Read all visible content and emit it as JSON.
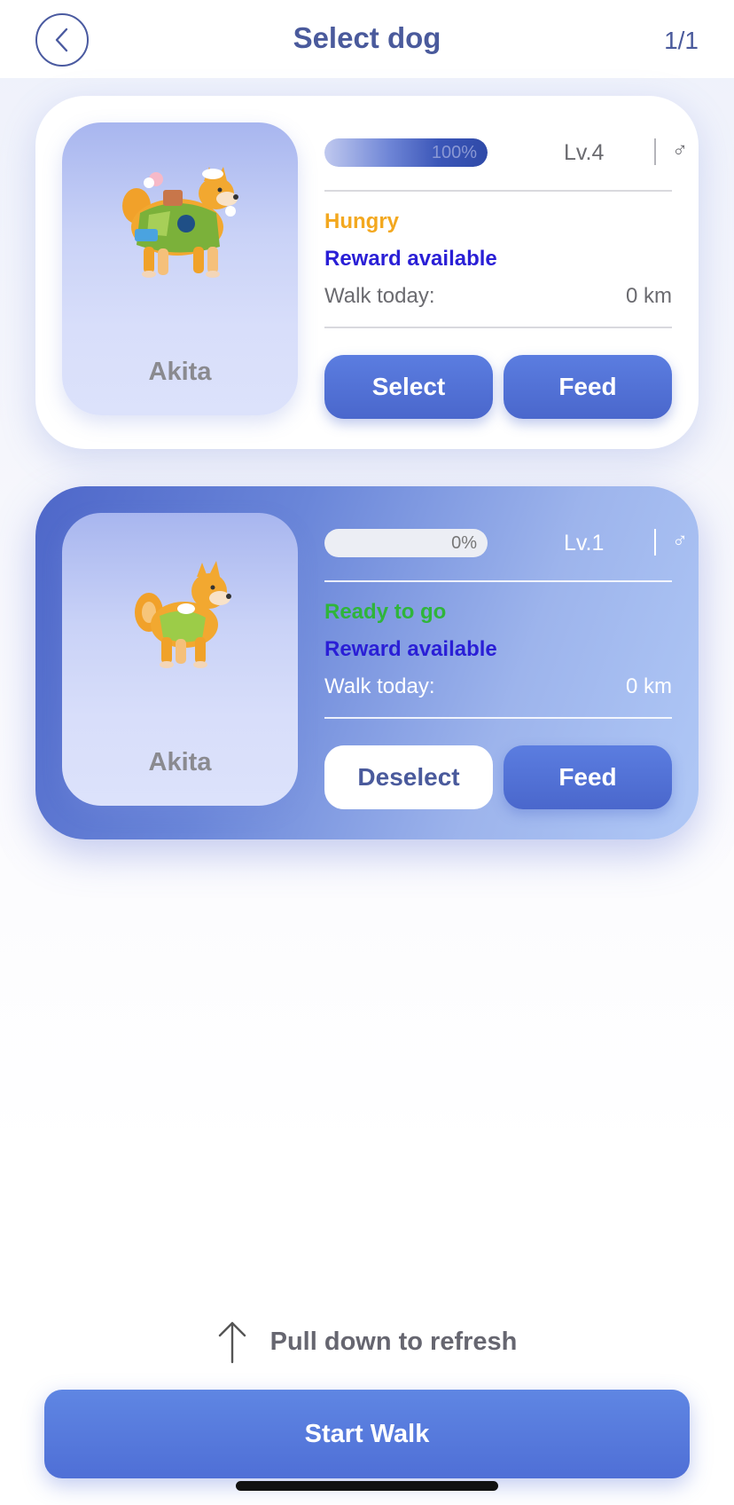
{
  "header": {
    "title": "Select dog",
    "page_count": "1/1",
    "back_icon": "chevron-left-icon"
  },
  "dogs": [
    {
      "name": "Akita",
      "progress": 100,
      "progress_label": "100%",
      "level": "Lv.4",
      "gender_symbol": "♂",
      "status": "Hungry",
      "reward": "Reward available",
      "walk_label": "Walk today:",
      "walk_value": "0 km",
      "primary_action": "Select",
      "secondary_action": "Feed",
      "selected": false
    },
    {
      "name": "Akita",
      "progress": 0,
      "progress_label": "0%",
      "level": "Lv.1",
      "gender_symbol": "♂",
      "status": "Ready to go",
      "reward": "Reward available",
      "walk_label": "Walk today:",
      "walk_value": "0 km",
      "primary_action": "Deselect",
      "secondary_action": "Feed",
      "selected": true
    }
  ],
  "footer": {
    "refresh_hint": "Pull down to refresh",
    "refresh_icon": "arrow-up-icon",
    "start_walk": "Start Walk"
  },
  "colors": {
    "accent": "#4a67cc",
    "title": "#4a5a9c",
    "hungry": "#f3a81f",
    "ready": "#2fb53b",
    "reward": "#2a1fd6"
  }
}
